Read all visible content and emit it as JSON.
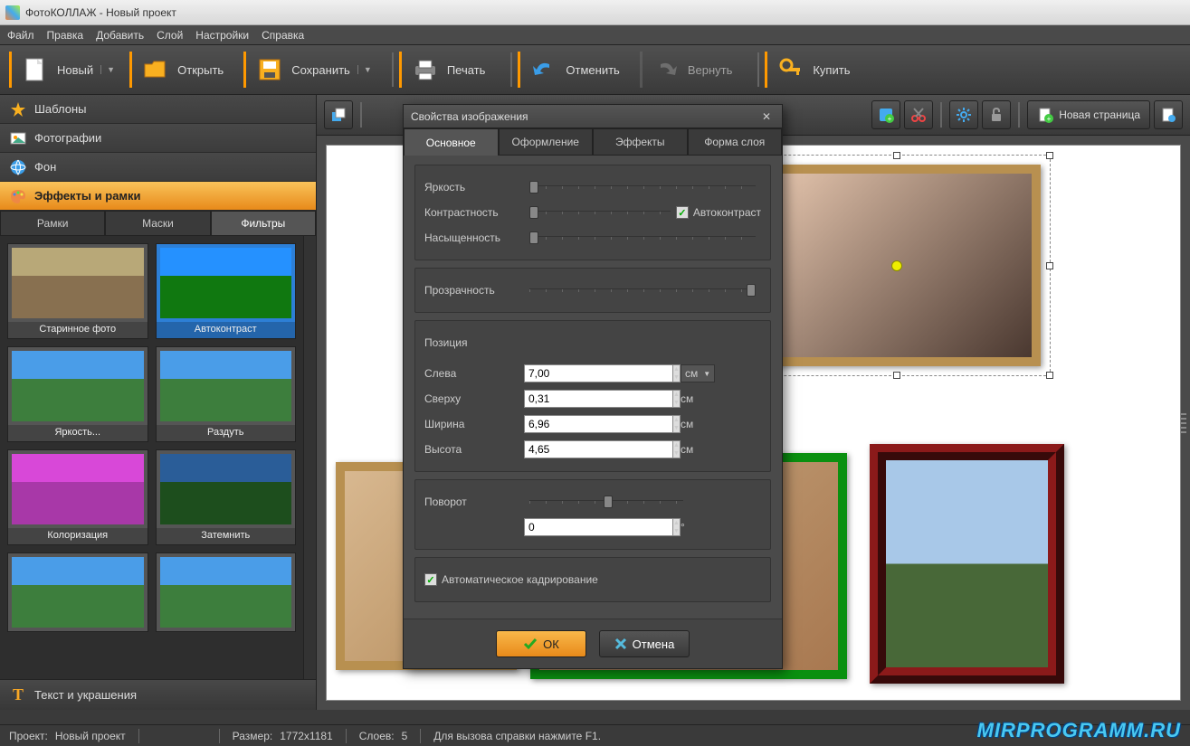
{
  "window_title": "ФотоКОЛЛАЖ - Новый проект",
  "menu": [
    "Файл",
    "Правка",
    "Добавить",
    "Слой",
    "Настройки",
    "Справка"
  ],
  "toolbar": {
    "new": "Новый",
    "open": "Открыть",
    "save": "Сохранить",
    "print": "Печать",
    "undo": "Отменить",
    "redo": "Вернуть",
    "buy": "Купить"
  },
  "sidebar": {
    "templates": "Шаблоны",
    "photos": "Фотографии",
    "background": "Фон",
    "effects": "Эффекты и рамки",
    "text_deco": "Текст и украшения"
  },
  "subtabs": {
    "frames": "Рамки",
    "masks": "Маски",
    "filters": "Фильтры"
  },
  "thumbs": [
    "Старинное фото",
    "Автоконтраст",
    "Яркость...",
    "Раздуть",
    "Колоризация",
    "Затемнить"
  ],
  "canvas_toolbar": {
    "new_page": "Новая страница"
  },
  "dialog": {
    "title": "Свойства изображения",
    "tabs": [
      "Основное",
      "Оформление",
      "Эффекты",
      "Форма слоя"
    ],
    "brightness": "Яркость",
    "contrast": "Контрастность",
    "saturation": "Насыщенность",
    "autocontrast": "Автоконтраст",
    "opacity": "Прозрачность",
    "position": "Позиция",
    "left": "Слева",
    "top": "Сверху",
    "width": "Ширина",
    "height": "Высота",
    "rotation": "Поворот",
    "autocrop": "Автоматическое кадрирование",
    "unit": "см",
    "deg": "°",
    "ok": "ОК",
    "cancel": "Отмена",
    "values": {
      "left": "7,00",
      "top": "0,31",
      "width": "6,96",
      "height": "4,65",
      "rotation": "0"
    }
  },
  "status": {
    "project_lbl": "Проект:",
    "project": "Новый проект",
    "size_lbl": "Размер:",
    "size": "1772x1181",
    "layers_lbl": "Слоев:",
    "layers": "5",
    "help": "Для вызова справки нажмите F1."
  },
  "watermark": "MIRPROGRAMM.RU"
}
